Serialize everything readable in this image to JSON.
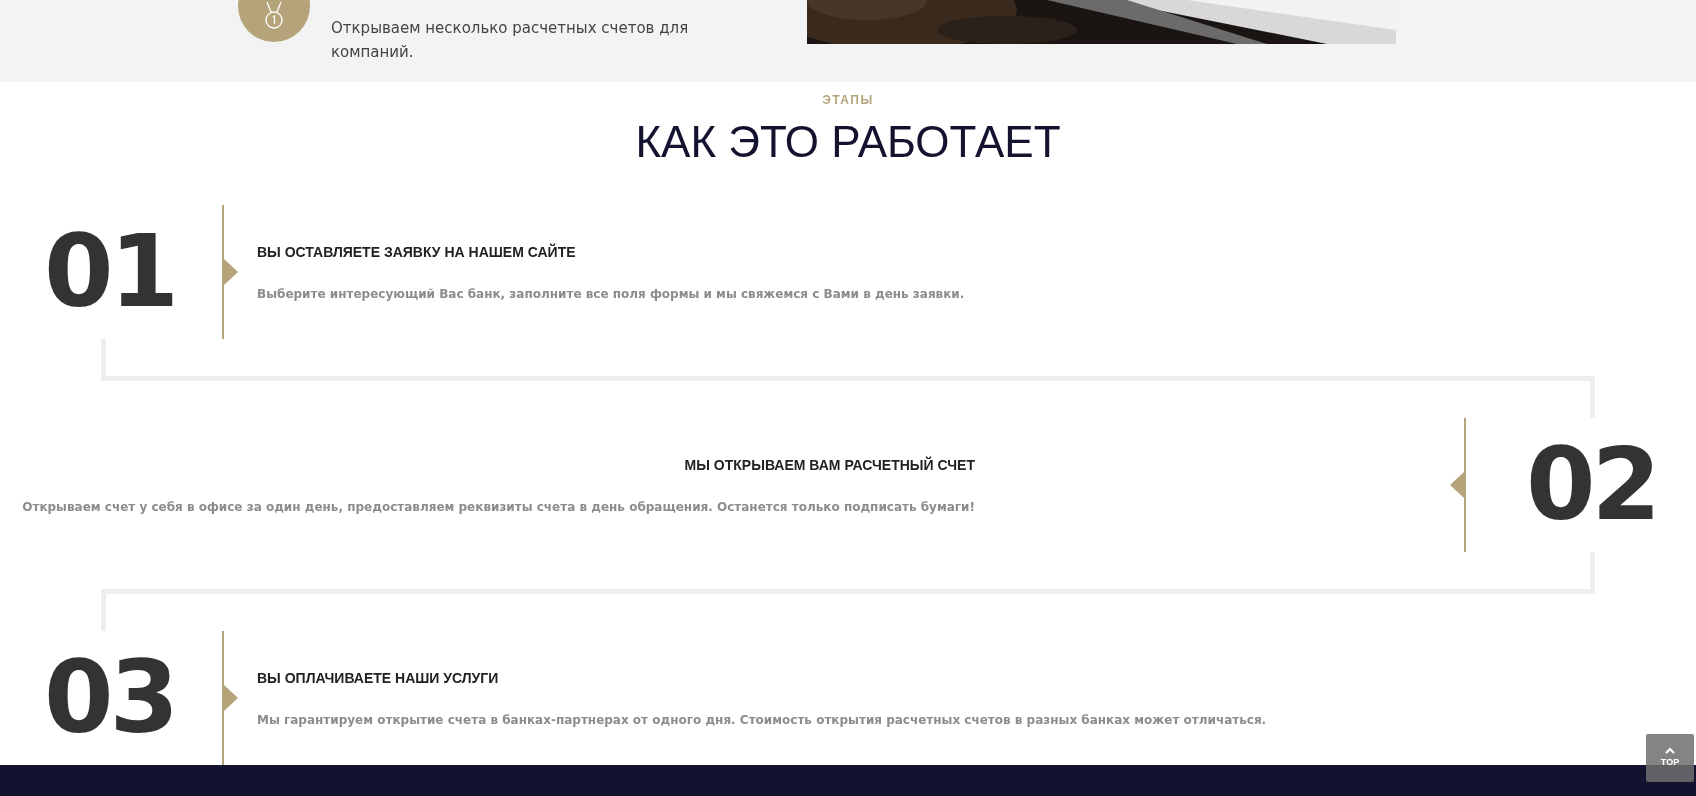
{
  "feature": {
    "text": "Открываем несколько расчетных счетов для компаний."
  },
  "section": {
    "eyebrow": "ЭТАПЫ",
    "title": "КАК ЭТО РАБОТАЕТ"
  },
  "steps": [
    {
      "number": "01",
      "title": "ВЫ ОСТАВЛЯЕТЕ ЗАЯВКУ НА НАШЕМ САЙТЕ",
      "description": "Выберите интересующий Вас банк, заполните все поля формы и мы свяжемся с Вами в день заявки.",
      "kind": "left"
    },
    {
      "number": "02",
      "title": "МЫ ОТКРЫВАЕМ ВАМ РАСЧЕТНЫЙ СЧЕТ",
      "description": "Открываем счет у себя в офисе за один день, предоставляем реквизиты счета в день обращения. Останется только подписать бумаги!",
      "kind": "right"
    },
    {
      "number": "03",
      "title": "ВЫ ОПЛАЧИВАЕТЕ НАШИ УСЛУГИ",
      "description": "Мы гарантируем открытие счета в банках-партнерах от одного дня. Стоимость открытия расчетных счетов в разных банках может отличаться.",
      "kind": "left"
    }
  ],
  "back_to_top": {
    "label": "TOP"
  }
}
